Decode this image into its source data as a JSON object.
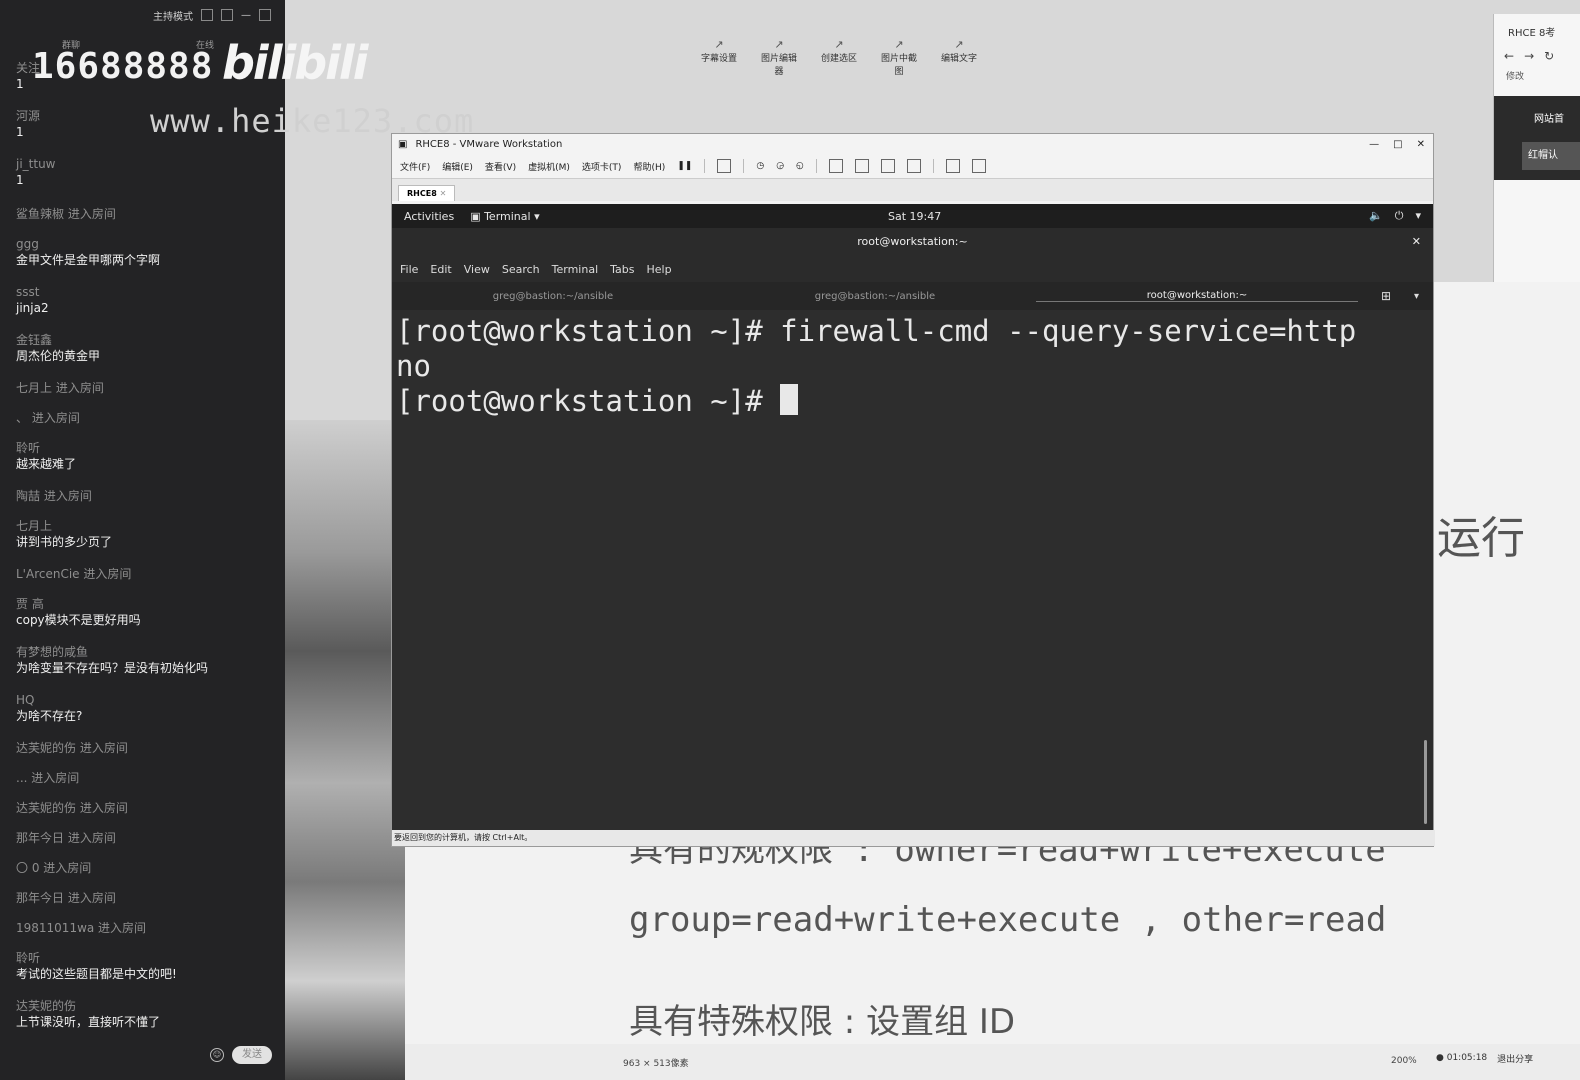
{
  "chat": {
    "mode_label": "主持模式",
    "watermark_number": "16688888",
    "watermark_logo": "bilibili",
    "watermark_url": "www.heike123.com",
    "sub_tabs": [
      "群聊",
      "在线"
    ],
    "messages": [
      {
        "user": "关注",
        "text": "1"
      },
      {
        "user": "河源",
        "text": "1"
      },
      {
        "user": "ji_ttuw",
        "text": "1"
      },
      {
        "join": "鲨鱼辣椒 进入房间"
      },
      {
        "user": "ggg",
        "text": "金甲文件是金甲哪两个字啊"
      },
      {
        "user": "ssst",
        "text": "jinja2"
      },
      {
        "user": "金钰鑫",
        "text": "周杰伦的黄金甲"
      },
      {
        "join": "七月上 进入房间"
      },
      {
        "join": "、 进入房间"
      },
      {
        "user": "聆听",
        "text": "越来越难了"
      },
      {
        "join": "陶喆 进入房间"
      },
      {
        "user": "七月上",
        "text": "讲到书的多少页了"
      },
      {
        "join": "L'ArcenCie 进入房间"
      },
      {
        "user": "贾 高",
        "text": "copy模块不是更好用吗"
      },
      {
        "user": "有梦想的咸鱼",
        "text": "为啥变量不存在吗？是没有初始化吗"
      },
      {
        "user": "HQ",
        "text": "为啥不存在?"
      },
      {
        "join": "达芙妮的伤 进入房间"
      },
      {
        "join": "... 进入房间"
      },
      {
        "join": "达芙妮的伤 进入房间"
      },
      {
        "join": "那年今日 进入房间"
      },
      {
        "join": "〇 0 进入房间"
      },
      {
        "join": "那年今日 进入房间"
      },
      {
        "join": "19811011wa 进入房间"
      },
      {
        "user": "聆听",
        "text": "考试的这些题目都是中文的吧!"
      },
      {
        "user": "达芙妮的伤",
        "text": "上节课没听，直接听不懂了"
      }
    ],
    "send_label": "发送"
  },
  "bg_tools": [
    "字幕设置",
    "图片编辑器",
    "创建选区",
    "图片中截图",
    "编辑文字"
  ],
  "browser": {
    "tab_title": "RHCE 8考",
    "bookmark": "修改",
    "home_label": "网站首",
    "red_label": "红帽认"
  },
  "doc": {
    "line1": "具有的规权限 : owner=read+write+execute",
    "line2": "group=read+write+execute , other=read",
    "line3": "具有特殊权限 : 设置组 ID",
    "run_text": "运行",
    "size_readout": "963 × 513像素",
    "zoom": "200%"
  },
  "vmware": {
    "title": "RHCE8 - VMware Workstation",
    "menus": [
      "文件(F)",
      "编辑(E)",
      "查看(V)",
      "虚拟机(M)",
      "选项卡(T)",
      "帮助(H)"
    ],
    "vm_tab": "RHCE8",
    "status_text": "要返回到您的计算机，请按 Ctrl+Alt。"
  },
  "gnome": {
    "activities": "Activities",
    "app_menu": "Terminal",
    "clock": "Sat 19:47",
    "window_title": "root@workstation:~",
    "term_menu": [
      "File",
      "Edit",
      "View",
      "Search",
      "Terminal",
      "Tabs",
      "Help"
    ],
    "term_tabs": [
      {
        "label": "greg@bastion:~/ansible",
        "active": false
      },
      {
        "label": "greg@bastion:~/ansible",
        "active": false
      },
      {
        "label": "root@workstation:~",
        "active": true
      }
    ],
    "console_lines": [
      "[root@workstation ~]# firewall-cmd --query-service=http",
      "no",
      "[root@workstation ~]# "
    ]
  },
  "taskbar": {
    "timer": "01:05:18",
    "exit_share": "退出分享"
  }
}
